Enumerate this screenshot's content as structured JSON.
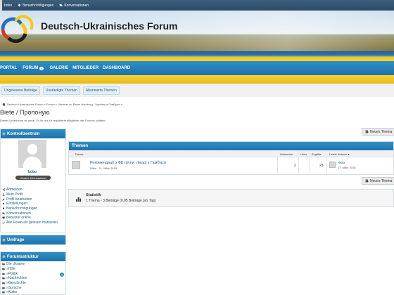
{
  "topbar": {
    "user": "bobo",
    "notifications": "Benachrichtigungen",
    "conversations": "Konversationen"
  },
  "header": {
    "title": "Deutsch-Ukrainisches Forum"
  },
  "nav": {
    "items": [
      {
        "label": "PORTAL"
      },
      {
        "label": "FORUM",
        "badge": "1"
      },
      {
        "label": "GALERIE"
      },
      {
        "label": "MITGLIEDER"
      },
      {
        "label": "DASHBOARD"
      }
    ]
  },
  "subtabs": [
    "Ungelesene Beiträge",
    "Unerledigte Themen",
    "Abonnierte Themen"
  ],
  "breadcrumb": "Deutsch-Ukrainisches Forum » Forum » Ukrainer im Raum Hamburg / Українці в Гамбурзі »",
  "page": {
    "title": "Biete / Пропоную",
    "description": "Dieses Unterforum ist privat. Es ist nur für registrierte Mitglieder des Forums sichtbar.",
    "new_thread": "Neues Thema"
  },
  "sidebar": {
    "kontrollzentrum": {
      "title": "Kontrollzentrum",
      "username": "bobo",
      "rank": "Ukraine-Interessierter",
      "links": [
        "Abmelden",
        "Mein Profil",
        "Profil bearbeiten",
        "Einstellungen",
        "Benachrichtigungen",
        "Konversationen",
        "Benutzer online",
        "Alle Foren als gelesen markieren"
      ]
    },
    "umfrage": {
      "title": "Umfrage"
    },
    "forumsstruktur": {
      "title": "Forumsstruktur",
      "items": [
        "Die Ukraine",
        "»Hilfe",
        "»Politik",
        "»Nachrichten",
        "»Geschichte",
        "»Sprache",
        "»Kultur"
      ],
      "badge": "1"
    }
  },
  "threads": {
    "title": "Themen",
    "columns": {
      "topic": "Thema",
      "replies": "Antworten",
      "likes": "Likes",
      "views": "Zugriffe",
      "last": "Letzte Antwort ▾"
    },
    "rows": [
      {
        "title": "Рекомендації з ФБ групи: лікарі у Гамбурзі",
        "author": "Ritka",
        "date": "11. März 2015",
        "replies": "2",
        "likes": "",
        "views": "23",
        "last_user": "Ritka",
        "last_date": "17. März 2015"
      }
    ]
  },
  "stats": {
    "title": "Statistik",
    "text": "1 Thema - 3 Beiträge (0,05 Beiträge pro Tag)"
  },
  "colors": {
    "nav_blue": "#1e73ab",
    "accent_yellow": "#f2c91d",
    "topbar": "#2b4a66",
    "link": "#1f5f86"
  }
}
